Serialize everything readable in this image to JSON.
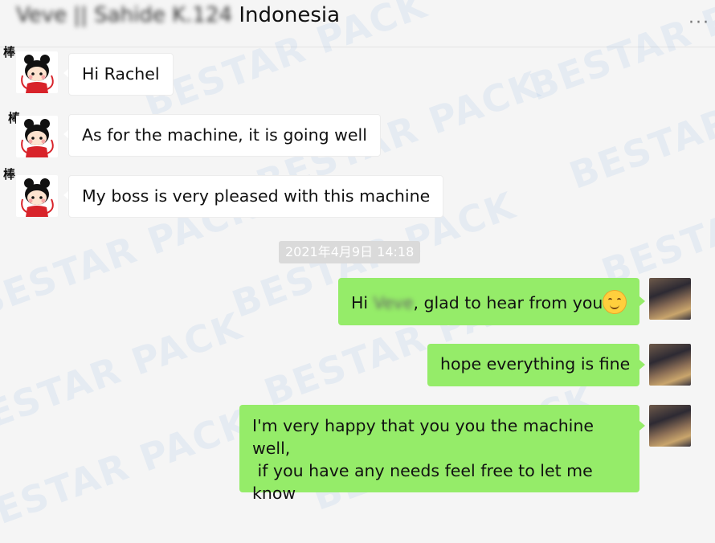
{
  "header": {
    "title_prefix": "Veve || Sahide K.124",
    "title_suffix": "Indonesia",
    "more_icon": "more-icon"
  },
  "watermark": "BESTAR PACK",
  "contact": {
    "badge": "棒"
  },
  "messages_in": [
    {
      "text": "Hi Rachel"
    },
    {
      "text": "As for the machine, it is going well"
    },
    {
      "text": "My boss is very pleased with this machine"
    }
  ],
  "timestamp": "2021年4月9日 14:18",
  "messages_out": [
    {
      "text_before": "Hi ",
      "blurred_name": "Veve",
      "text_after": ", glad to hear from you",
      "emoji": "smiling-face-icon"
    },
    {
      "text": "hope everything is fine"
    },
    {
      "text": "I'm very happy that you you the machine well,\n if you have any needs feel free to let me know"
    }
  ],
  "colors": {
    "outgoing": "#95ec69",
    "incoming": "#ffffff",
    "background": "#f5f5f5"
  }
}
